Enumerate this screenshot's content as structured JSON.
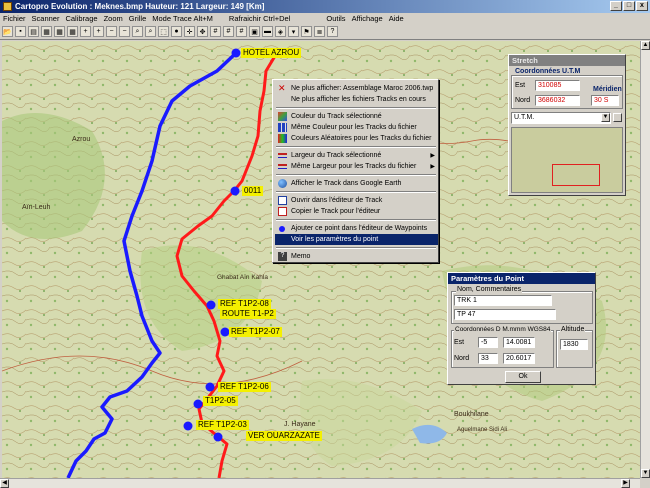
{
  "window": {
    "title": "Cartopro Evolution :  Meknes.bmp   Hauteur: 121  Largeur: 149  [Km]",
    "min": "_",
    "max": "□",
    "close": "x"
  },
  "menu": [
    "Fichier",
    "Scanner",
    "Calibrage",
    "Zoom",
    "Grille",
    "Mode Trace Alt+M",
    "Rafraichir Ctrl+Del",
    "Outils",
    "Affichage",
    "Aide"
  ],
  "toolbar_icons": [
    "open-icon",
    "save-icon",
    "print-icon",
    "image-icon",
    "image-icon",
    "image-icon",
    "zoom-in-icon",
    "zoom-in-icon",
    "zoom-out-icon",
    "zoom-out-icon",
    "zoom-icon",
    "zoom-icon",
    "select-icon",
    "dot-icon",
    "crosshair-icon",
    "move-icon",
    "grid-icon",
    "grid-icon",
    "grid-icon",
    "map-icon",
    "car-icon",
    "gps-icon",
    "dropdown-icon",
    "flag-icon",
    "layers-icon",
    "help-icon"
  ],
  "map_labels": {
    "hotel": "HOTEL AZROU",
    "wp0011": "0011",
    "ref1": "REF  T1P2-08",
    "route": "ROUTE  T1-P2",
    "ref2": "REF  T1P2-07",
    "ref3": "REF  T1P2-06",
    "ref4": "T1P2-05",
    "ref5": "REF  T1P2-03",
    "ver": "VER OUARZAZATE",
    "place_azrou": "Azrou",
    "place_ain_leuh": "Aïn-Leuh",
    "place_ghabat": "Ghabat Aïn Kahla",
    "place_hayane": "J. Hayane",
    "place_boukhilane": "Boukhilane",
    "place_aguelmane": "Aguelmane Sidi Ali"
  },
  "context_menu": {
    "items": [
      {
        "label": "Ne plus afficher: Assemblage Maroc 2006.twp",
        "icon": "x-icon"
      },
      {
        "label": "Ne plus afficher les fichiers Tracks en cours",
        "icon": ""
      },
      {
        "label": "Couleur du Track sélectionné",
        "icon": "color-icon"
      },
      {
        "label": "Même Couleur pour les Tracks du fichier",
        "icon": "palette-icon"
      },
      {
        "label": "Couleurs Aléatoires pour les Tracks du fichier",
        "icon": "random-color-icon"
      },
      {
        "label": "Largeur du Track sélectionné",
        "icon": "width-icon",
        "submenu": true
      },
      {
        "label": "Même Largeur pour les Tracks du fichier",
        "icon": "width-icon",
        "submenu": true
      },
      {
        "label": "Afficher le Track dans Google Earth",
        "icon": "earth-icon"
      },
      {
        "label": "Ouvrir dans l'éditeur de Track",
        "icon": "editor-icon"
      },
      {
        "label": "Copier le Track pour l'éditeur",
        "icon": "copy-icon"
      },
      {
        "label": "Ajouter ce point dans l'éditeur de Waypoints",
        "icon": "waypoint-icon"
      },
      {
        "label": "Voir les paramètres du point",
        "icon": "",
        "selected": true
      },
      {
        "label": "Memo",
        "icon": "memo-icon"
      }
    ],
    "arrow": "▶"
  },
  "stretch": {
    "title": "Stretch",
    "coords_label": "Coordonnées U.T.M",
    "est_label": "Est",
    "est_value": "310085",
    "nord_label": "Nord",
    "nord_value": "3686032",
    "meridien_label": "Méridien",
    "meridien_value": "30 S",
    "projection": "U.T.M."
  },
  "params": {
    "title": "Paramètres du Point",
    "nom_label": "Nom, Commentaires",
    "nom_value": "TRK 1",
    "comment_value": "TP 47",
    "coords_label": "Coordonnées D M.mmm  WGS84",
    "altitude_label": "Altitude",
    "est_label": "Est",
    "est_deg": "-5",
    "est_min": "14.0081",
    "nord_label": "Nord",
    "nord_deg": "33",
    "nord_min": "20.6017",
    "altitude_value": "1830",
    "ok": "Ok"
  },
  "colors": {
    "titlebar": "#0a246a",
    "track_red": "#ff1a1a",
    "track_blue": "#1a1aff",
    "label_bg": "#f4f000",
    "value_red": "#d00000"
  }
}
